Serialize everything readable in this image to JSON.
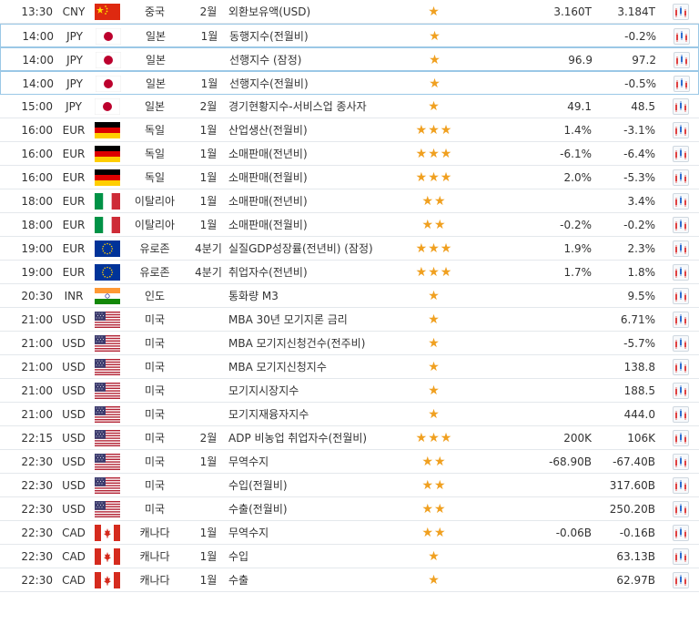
{
  "colors": {
    "star": "#f0a020",
    "highlight_border": "#9bc8e6"
  },
  "rows": [
    {
      "time": "13:30",
      "currency": "CNY",
      "flag": "cn",
      "country": "중국",
      "period": "2월",
      "event": "외환보유액(USD)",
      "stars": 1,
      "actual": "3.160T",
      "previous": "3.184T",
      "hl": false
    },
    {
      "time": "14:00",
      "currency": "JPY",
      "flag": "jp",
      "country": "일본",
      "period": "1월",
      "event": "동행지수(전월비)",
      "stars": 1,
      "actual": "",
      "previous": "-0.2%",
      "hl": true
    },
    {
      "time": "14:00",
      "currency": "JPY",
      "flag": "jp",
      "country": "일본",
      "period": "",
      "event": "선행지수 (잠정)",
      "stars": 1,
      "actual": "96.9",
      "previous": "97.2",
      "hl": true
    },
    {
      "time": "14:00",
      "currency": "JPY",
      "flag": "jp",
      "country": "일본",
      "period": "1월",
      "event": "선행지수(전월비)",
      "stars": 1,
      "actual": "",
      "previous": "-0.5%",
      "hl": true
    },
    {
      "time": "15:00",
      "currency": "JPY",
      "flag": "jp",
      "country": "일본",
      "period": "2월",
      "event": "경기현황지수-서비스업 종사자",
      "stars": 1,
      "actual": "49.1",
      "previous": "48.5",
      "hl": false
    },
    {
      "time": "16:00",
      "currency": "EUR",
      "flag": "de",
      "country": "독일",
      "period": "1월",
      "event": "산업생산(전월비)",
      "stars": 3,
      "actual": "1.4%",
      "previous": "-3.1%",
      "hl": false
    },
    {
      "time": "16:00",
      "currency": "EUR",
      "flag": "de",
      "country": "독일",
      "period": "1월",
      "event": "소매판매(전년비)",
      "stars": 3,
      "actual": "-6.1%",
      "previous": "-6.4%",
      "hl": false
    },
    {
      "time": "16:00",
      "currency": "EUR",
      "flag": "de",
      "country": "독일",
      "period": "1월",
      "event": "소매판매(전월비)",
      "stars": 3,
      "actual": "2.0%",
      "previous": "-5.3%",
      "hl": false
    },
    {
      "time": "18:00",
      "currency": "EUR",
      "flag": "it",
      "country": "이탈리아",
      "period": "1월",
      "event": "소매판매(전년비)",
      "stars": 2,
      "actual": "",
      "previous": "3.4%",
      "hl": false
    },
    {
      "time": "18:00",
      "currency": "EUR",
      "flag": "it",
      "country": "이탈리아",
      "period": "1월",
      "event": "소매판매(전월비)",
      "stars": 2,
      "actual": "-0.2%",
      "previous": "-0.2%",
      "hl": false
    },
    {
      "time": "19:00",
      "currency": "EUR",
      "flag": "eu",
      "country": "유로존",
      "period": "4분기",
      "event": "실질GDP성장률(전년비) (잠정)",
      "stars": 3,
      "actual": "1.9%",
      "previous": "2.3%",
      "hl": false
    },
    {
      "time": "19:00",
      "currency": "EUR",
      "flag": "eu",
      "country": "유로존",
      "period": "4분기",
      "event": "취업자수(전년비)",
      "stars": 3,
      "actual": "1.7%",
      "previous": "1.8%",
      "hl": false
    },
    {
      "time": "20:30",
      "currency": "INR",
      "flag": "in",
      "country": "인도",
      "period": "",
      "event": "통화량 M3",
      "stars": 1,
      "actual": "",
      "previous": "9.5%",
      "hl": false
    },
    {
      "time": "21:00",
      "currency": "USD",
      "flag": "us",
      "country": "미국",
      "period": "",
      "event": "MBA 30년 모기지론 금리",
      "stars": 1,
      "actual": "",
      "previous": "6.71%",
      "hl": false
    },
    {
      "time": "21:00",
      "currency": "USD",
      "flag": "us",
      "country": "미국",
      "period": "",
      "event": "MBA 모기지신청건수(전주비)",
      "stars": 1,
      "actual": "",
      "previous": "-5.7%",
      "hl": false
    },
    {
      "time": "21:00",
      "currency": "USD",
      "flag": "us",
      "country": "미국",
      "period": "",
      "event": "MBA 모기지신청지수",
      "stars": 1,
      "actual": "",
      "previous": "138.8",
      "hl": false
    },
    {
      "time": "21:00",
      "currency": "USD",
      "flag": "us",
      "country": "미국",
      "period": "",
      "event": "모기지시장지수",
      "stars": 1,
      "actual": "",
      "previous": "188.5",
      "hl": false
    },
    {
      "time": "21:00",
      "currency": "USD",
      "flag": "us",
      "country": "미국",
      "period": "",
      "event": "모기지재융자지수",
      "stars": 1,
      "actual": "",
      "previous": "444.0",
      "hl": false
    },
    {
      "time": "22:15",
      "currency": "USD",
      "flag": "us",
      "country": "미국",
      "period": "2월",
      "event": "ADP 비농업 취업자수(전월비)",
      "stars": 3,
      "actual": "200K",
      "previous": "106K",
      "hl": false
    },
    {
      "time": "22:30",
      "currency": "USD",
      "flag": "us",
      "country": "미국",
      "period": "1월",
      "event": "무역수지",
      "stars": 2,
      "actual": "-68.90B",
      "previous": "-67.40B",
      "hl": false
    },
    {
      "time": "22:30",
      "currency": "USD",
      "flag": "us",
      "country": "미국",
      "period": "",
      "event": "수입(전월비)",
      "stars": 2,
      "actual": "",
      "previous": "317.60B",
      "hl": false
    },
    {
      "time": "22:30",
      "currency": "USD",
      "flag": "us",
      "country": "미국",
      "period": "",
      "event": "수출(전월비)",
      "stars": 2,
      "actual": "",
      "previous": "250.20B",
      "hl": false
    },
    {
      "time": "22:30",
      "currency": "CAD",
      "flag": "ca",
      "country": "캐나다",
      "period": "1월",
      "event": "무역수지",
      "stars": 2,
      "actual": "-0.06B",
      "previous": "-0.16B",
      "hl": false
    },
    {
      "time": "22:30",
      "currency": "CAD",
      "flag": "ca",
      "country": "캐나다",
      "period": "1월",
      "event": "수입",
      "stars": 1,
      "actual": "",
      "previous": "63.13B",
      "hl": false
    },
    {
      "time": "22:30",
      "currency": "CAD",
      "flag": "ca",
      "country": "캐나다",
      "period": "1월",
      "event": "수출",
      "stars": 1,
      "actual": "",
      "previous": "62.97B",
      "hl": false
    }
  ]
}
